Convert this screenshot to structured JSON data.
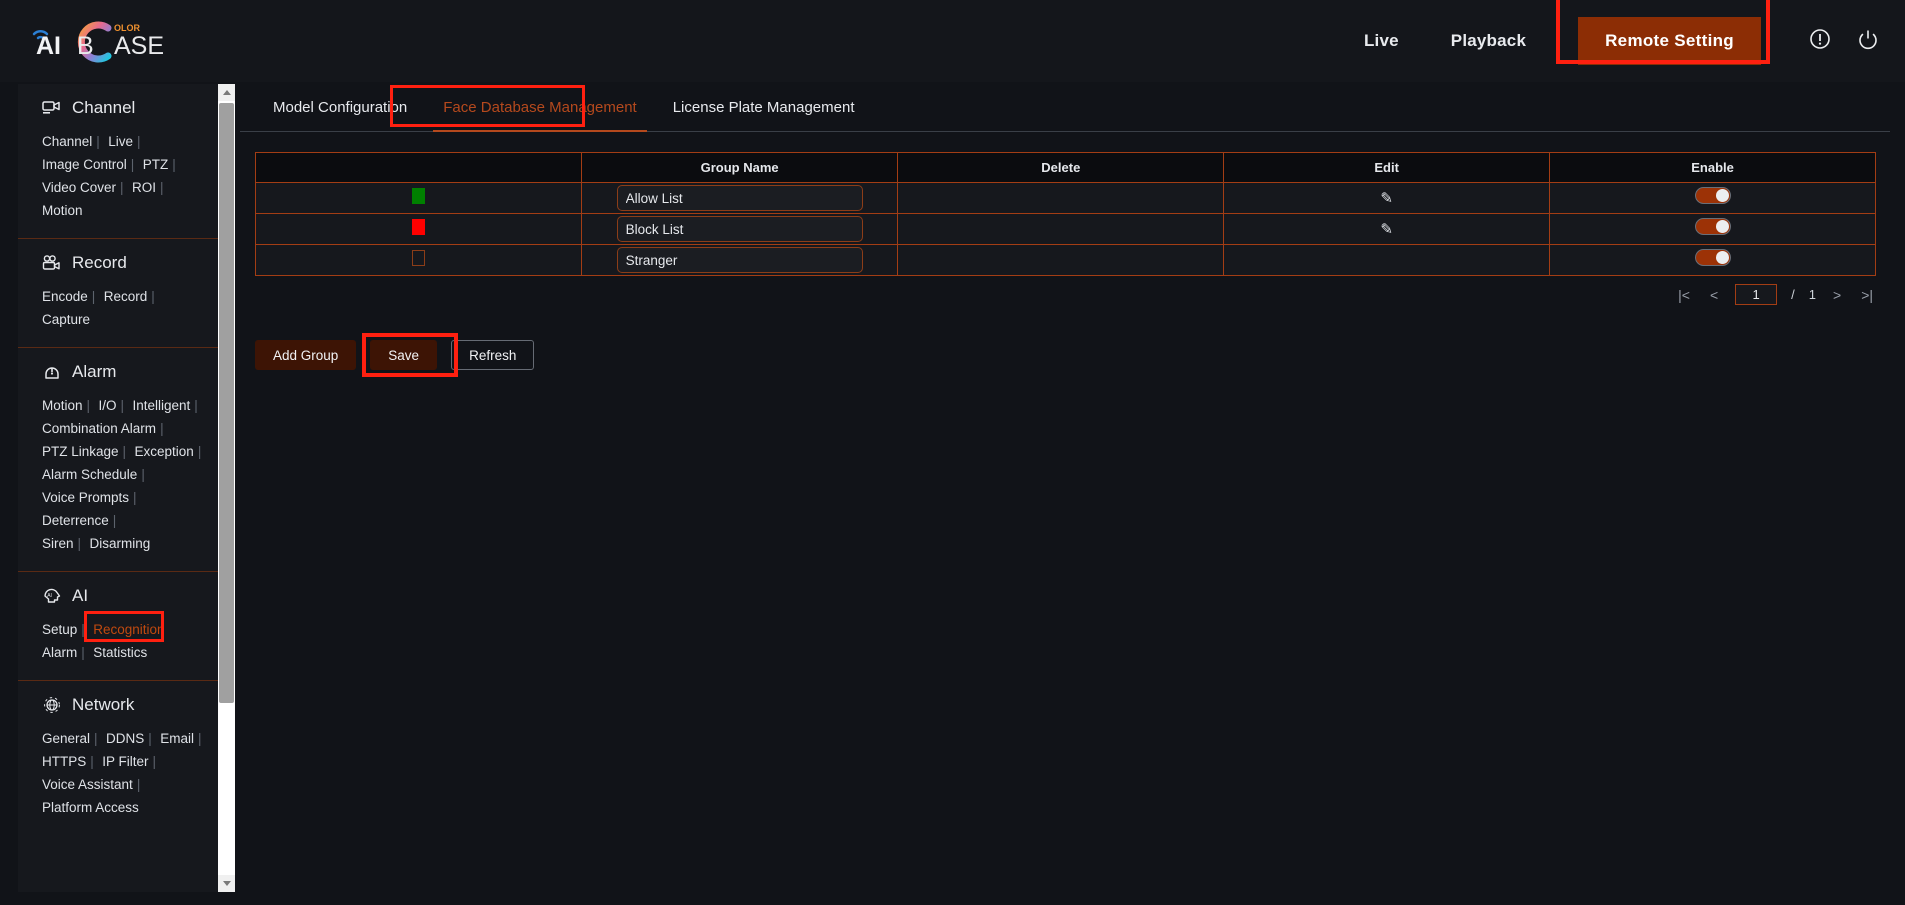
{
  "header": {
    "logo": {
      "text_ai": "AI",
      "text_base": "BASE",
      "text_olor": "OLOR"
    },
    "nav": [
      {
        "label": "Live",
        "name": "nav-live"
      },
      {
        "label": "Playback",
        "name": "nav-playback"
      }
    ],
    "remote_setting_label": "Remote Setting",
    "icons": [
      {
        "name": "alert-info-icon",
        "glyph": "!"
      },
      {
        "name": "power-icon",
        "glyph": "power"
      }
    ],
    "accent_button_color": "#8c2d05",
    "annotation_color": "#ff2010"
  },
  "sidebar": {
    "sections": [
      {
        "title": "Channel",
        "icon": "camera-icon",
        "links": [
          "Channel",
          "Live",
          "Image Control",
          "PTZ",
          "Video Cover",
          "ROI",
          "Motion"
        ],
        "rows": [
          [
            "Channel",
            "Live"
          ],
          [
            "Image Control",
            "PTZ"
          ],
          [
            "Video Cover",
            "ROI",
            "Motion"
          ]
        ],
        "active": null
      },
      {
        "title": "Record",
        "icon": "video-record-icon",
        "rows": [
          [
            "Encode",
            "Record",
            "Capture"
          ]
        ],
        "active": null
      },
      {
        "title": "Alarm",
        "icon": "alarm-bell-icon",
        "rows": [
          [
            "Motion",
            "I/O",
            "Intelligent"
          ],
          [
            "Combination Alarm"
          ],
          [
            "PTZ Linkage",
            "Exception"
          ],
          [
            "Alarm Schedule"
          ],
          [
            "Voice Prompts",
            "Deterrence"
          ],
          [
            "Siren",
            "Disarming"
          ]
        ],
        "active": null
      },
      {
        "title": "AI",
        "icon": "ai-head-icon",
        "rows": [
          [
            "Setup",
            "Recognition"
          ],
          [
            "Alarm",
            "Statistics"
          ]
        ],
        "active": "Recognition"
      },
      {
        "title": "Network",
        "icon": "globe-network-icon",
        "rows": [
          [
            "General",
            "DDNS",
            "Email"
          ],
          [
            "HTTPS",
            "IP Filter"
          ],
          [
            "Voice Assistant"
          ],
          [
            "Platform Access"
          ]
        ],
        "active": null
      }
    ],
    "active_link_color": "#c0490f"
  },
  "tabs": [
    {
      "label": "Model Configuration",
      "name": "tab-model-configuration",
      "active": false
    },
    {
      "label": "Face Database Management",
      "name": "tab-face-database-management",
      "active": true
    },
    {
      "label": "License Plate Management",
      "name": "tab-license-plate-management",
      "active": false
    }
  ],
  "table": {
    "columns": [
      "",
      "Group Name",
      "Delete",
      "Edit",
      "Enable"
    ],
    "rows": [
      {
        "color": "#008000",
        "color_filled": true,
        "group_name": "Allow List",
        "delete": "",
        "edit": "edit-pencil-icon",
        "enabled": true
      },
      {
        "color": "#ff0000",
        "color_filled": true,
        "group_name": "Block List",
        "delete": "",
        "edit": "edit-pencil-icon",
        "enabled": true
      },
      {
        "color": "",
        "color_filled": false,
        "group_name": "Stranger",
        "delete": "",
        "edit": "",
        "enabled": true
      }
    ]
  },
  "pagination": {
    "first": "|<",
    "prev": "<",
    "current_page": "1",
    "separator": "/",
    "total_pages": "1",
    "next": ">",
    "last": ">|"
  },
  "buttons": [
    {
      "label": "Add Group",
      "name": "add-group-button",
      "style": "filled",
      "annotated": false
    },
    {
      "label": "Save",
      "name": "save-button",
      "style": "filled",
      "annotated": true
    },
    {
      "label": "Refresh",
      "name": "refresh-button",
      "style": "ghost",
      "annotated": false
    }
  ]
}
